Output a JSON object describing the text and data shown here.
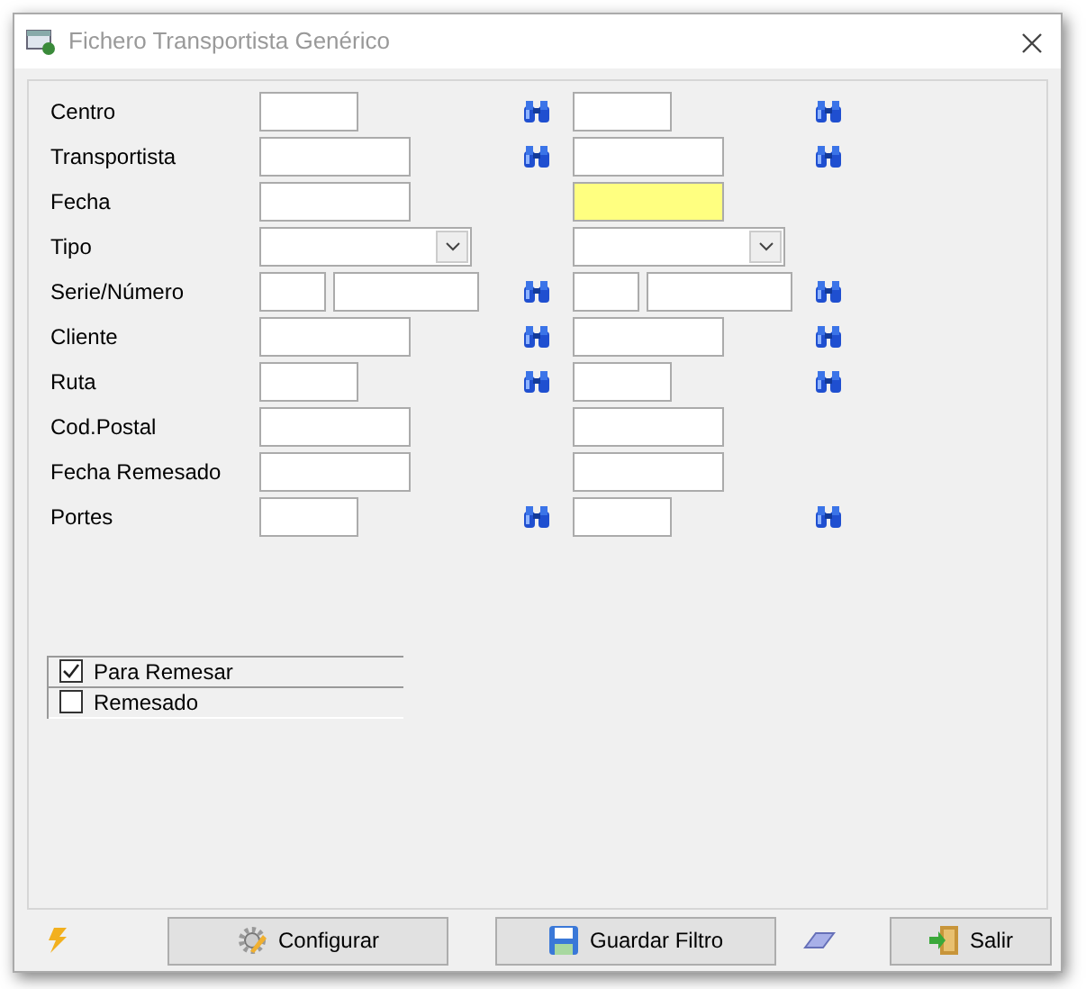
{
  "window": {
    "title": "Fichero Transportista Genérico"
  },
  "rows": [
    {
      "label": "Centro",
      "lookup": true,
      "from": {
        "kind": "short",
        "highlighted": false
      },
      "to": {
        "kind": "short",
        "highlighted": false
      }
    },
    {
      "label": "Transportista",
      "lookup": true,
      "from": {
        "kind": "medium",
        "highlighted": false
      },
      "to": {
        "kind": "medium",
        "highlighted": false
      }
    },
    {
      "label": "Fecha",
      "lookup": false,
      "from": {
        "kind": "medium",
        "highlighted": false
      },
      "to": {
        "kind": "medium",
        "highlighted": true
      }
    },
    {
      "label": "Tipo",
      "lookup": false,
      "from": {
        "kind": "combo",
        "highlighted": false
      },
      "to": {
        "kind": "combo",
        "highlighted": false
      }
    },
    {
      "label": "Serie/Número",
      "lookup": true,
      "from": {
        "kind": "pair",
        "highlighted": false
      },
      "to": {
        "kind": "pair",
        "highlighted": false
      }
    },
    {
      "label": "Cliente",
      "lookup": true,
      "from": {
        "kind": "medium",
        "highlighted": false
      },
      "to": {
        "kind": "medium",
        "highlighted": false
      }
    },
    {
      "label": "Ruta",
      "lookup": true,
      "from": {
        "kind": "short",
        "highlighted": false
      },
      "to": {
        "kind": "short",
        "highlighted": false
      }
    },
    {
      "label": "Cod.Postal",
      "lookup": false,
      "from": {
        "kind": "medium",
        "highlighted": false
      },
      "to": {
        "kind": "medium",
        "highlighted": false
      }
    },
    {
      "label": "Fecha Remesado",
      "lookup": false,
      "from": {
        "kind": "medium",
        "highlighted": false
      },
      "to": {
        "kind": "medium",
        "highlighted": false
      }
    },
    {
      "label": "Portes",
      "lookup": true,
      "from": {
        "kind": "short",
        "highlighted": false
      },
      "to": {
        "kind": "short",
        "highlighted": false
      }
    }
  ],
  "options": [
    {
      "label": "Para Remesar",
      "checked": true
    },
    {
      "label": "Remesado",
      "checked": false
    }
  ],
  "buttons": [
    {
      "label": "Configurar",
      "kind": "gear"
    },
    {
      "label": "Guardar Filtro",
      "kind": "save"
    },
    {
      "label": "Salir",
      "kind": "exit"
    }
  ]
}
